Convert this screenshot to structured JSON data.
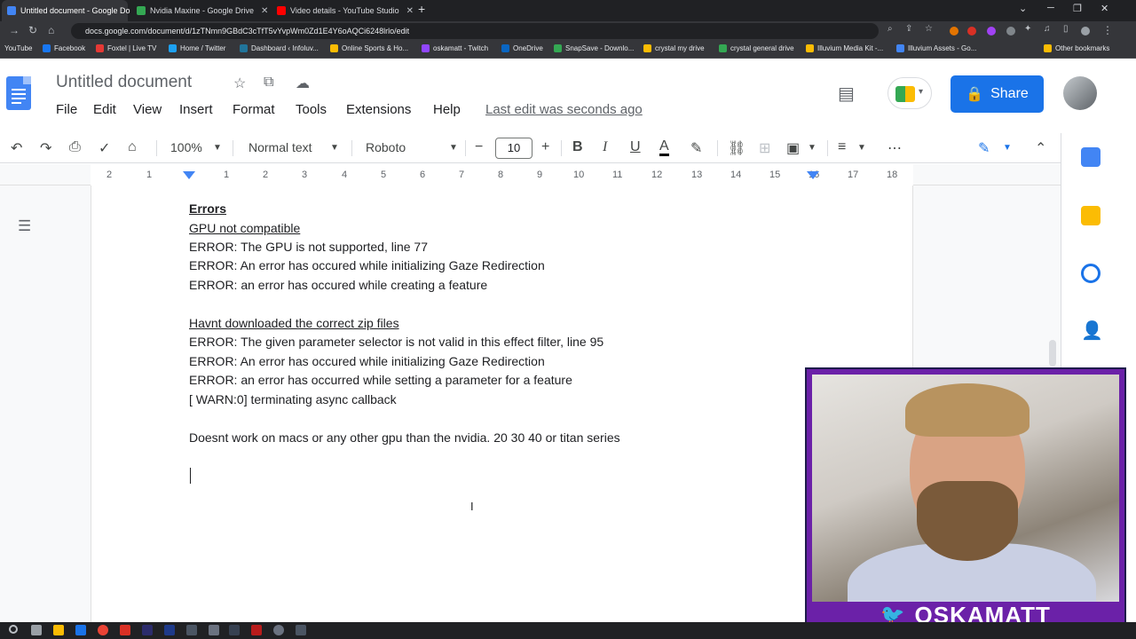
{
  "browser": {
    "tabs": [
      {
        "title": "Untitled document - Google Do",
        "color": "#4285f4"
      },
      {
        "title": "Nvidia Maxine - Google Drive",
        "color": "#34a853"
      },
      {
        "title": "Video details - YouTube Studio",
        "color": "#ff0000"
      }
    ],
    "url": "docs.google.com/document/d/1zTNmn9GBdC3cTfT5vYvpWm0Zd1E4Y6oAQCi6248lrlo/edit",
    "bookmarks": [
      {
        "label": "YouTube",
        "color": "#ff0000"
      },
      {
        "label": "Facebook",
        "color": "#1877f2"
      },
      {
        "label": "Foxtel | Live TV",
        "color": "#e53935"
      },
      {
        "label": "Home / Twitter",
        "color": "#1da1f2"
      },
      {
        "label": "Dashboard ‹ Infoluv...",
        "color": "#21759b"
      },
      {
        "label": "Online Sports & Ho...",
        "color": "#fbbc04"
      },
      {
        "label": "oskamatt - Twitch",
        "color": "#9146ff"
      },
      {
        "label": "OneDrive",
        "color": "#0a66c2"
      },
      {
        "label": "SnapSave - Downlo...",
        "color": "#34a853"
      },
      {
        "label": "crystal my drive",
        "color": "#fbbc04"
      },
      {
        "label": "crystal general drive",
        "color": "#34a853"
      },
      {
        "label": "Illuvium Media Kit -...",
        "color": "#fbbc04"
      },
      {
        "label": "Illuvium Assets - Go...",
        "color": "#4285f4"
      },
      {
        "label": "Other bookmarks",
        "color": "#fbbc04"
      }
    ]
  },
  "docs": {
    "title": "Untitled document",
    "menu": [
      "File",
      "Edit",
      "View",
      "Insert",
      "Format",
      "Tools",
      "Extensions",
      "Help"
    ],
    "last_edit": "Last edit was seconds ago",
    "share": "Share",
    "toolbar": {
      "zoom": "100%",
      "style": "Normal text",
      "font": "Roboto",
      "font_size": "10"
    },
    "ruler": [
      "2",
      "1",
      "1",
      "2",
      "3",
      "4",
      "5",
      "6",
      "7",
      "8",
      "9",
      "10",
      "11",
      "12",
      "13",
      "14",
      "15",
      "16",
      "17",
      "18"
    ]
  },
  "document": {
    "heading": "Errors",
    "section1_title": "GPU not compatible",
    "section1": [
      "ERROR: The GPU is not supported, line 77",
      "ERROR: An error has occured while initializing Gaze Redirection",
      "ERROR: an error has occured while creating a feature"
    ],
    "section2_title": "Havnt downloaded the correct zip files",
    "section2": [
      "ERROR: The given parameter selector is not valid in this effect filter, line 95",
      "ERROR: An error has occured while initializing Gaze Redirection",
      "ERROR: an error has occurred while setting a parameter for a feature",
      "[ WARN:0] terminating async callback"
    ],
    "note": "Doesnt work on macs or any other gpu than the nvidia. 20 30 40 or titan series"
  },
  "overlay": {
    "streamer_name": "OSKAMATT",
    "accent": "#6b21a8"
  }
}
